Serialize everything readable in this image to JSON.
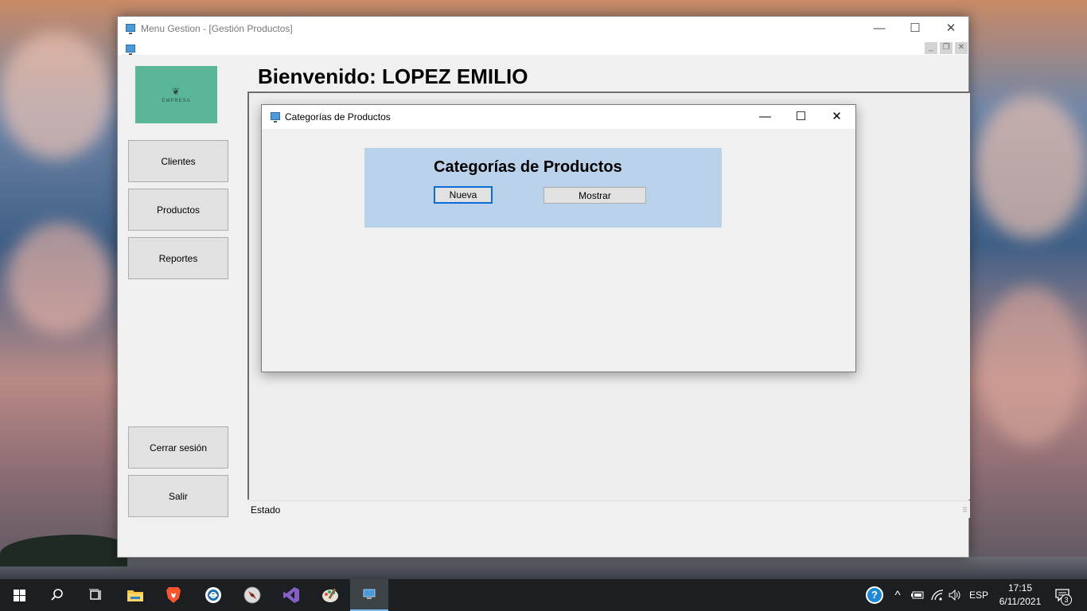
{
  "main_window": {
    "title": "Menu Gestion - [Gestión Productos]",
    "controls": {
      "minimize": "—",
      "maximize": "☐",
      "close": "✕"
    },
    "mdi_controls": {
      "minimize": "_",
      "restore": "❐",
      "close": "✕"
    }
  },
  "logo": {
    "mark": "❦",
    "text": "EMPRESA"
  },
  "sidebar": {
    "clientes": "Clientes",
    "productos": "Productos",
    "reportes": "Reportes",
    "cerrar_sesion": "Cerrar sesión",
    "salir": "Salir"
  },
  "welcome": "Bienvenido: LOPEZ EMILIO",
  "status": "Estado",
  "child_window": {
    "title": "Categorías de Productos",
    "controls": {
      "minimize": "—",
      "maximize": "☐",
      "close": "✕"
    },
    "heading": "Categorías de Productos",
    "nueva_label": "Nueva",
    "mostrar_label": "Mostrar"
  },
  "taskbar": {
    "icons": [
      "windows-start-icon",
      "search-icon",
      "task-view-icon",
      "file-explorer-icon",
      "brave-browser-icon",
      "edge-icon",
      "compass-icon",
      "visual-studio-icon",
      "paint-icon",
      "app-window-icon"
    ],
    "tray": {
      "help": "?",
      "chevron": "^",
      "language": "ESP"
    },
    "time": "17:15",
    "date": "6/11/2021",
    "notifications": "3"
  },
  "colors": {
    "logo_bg": "#5bb598",
    "category_panel": "#bad1ea",
    "focus_border": "#0a6cd4",
    "taskbar_bg": "#1b1f22"
  }
}
